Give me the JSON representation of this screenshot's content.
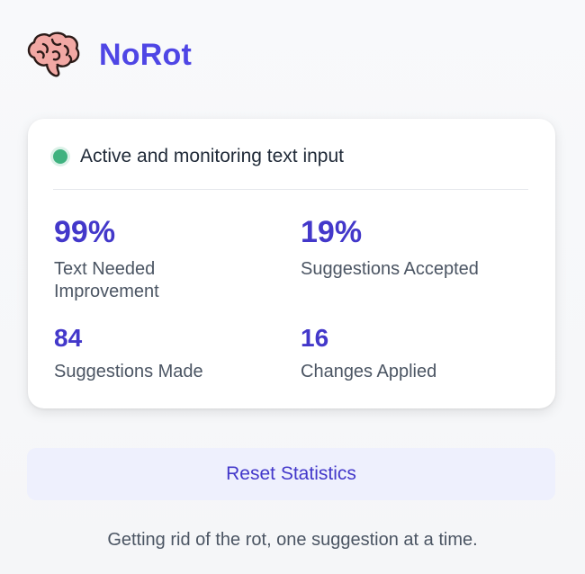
{
  "header": {
    "logo_icon": "brain-icon",
    "title": "NoRot"
  },
  "status": {
    "indicator_color": "#3fb27f",
    "text": "Active and monitoring text input"
  },
  "stats": [
    {
      "value": "99%",
      "label": "Text Needed Improvement"
    },
    {
      "value": "19%",
      "label": "Suggestions Accepted"
    },
    {
      "value": "84",
      "label": "Suggestions Made"
    },
    {
      "value": "16",
      "label": "Changes Applied"
    }
  ],
  "actions": {
    "reset_label": "Reset Statistics"
  },
  "footer": {
    "tagline": "Getting rid of the rot, one suggestion at a time."
  },
  "colors": {
    "accent": "#4f46e5",
    "stat_value": "#4338ca",
    "button_bg": "#eef0fd"
  }
}
